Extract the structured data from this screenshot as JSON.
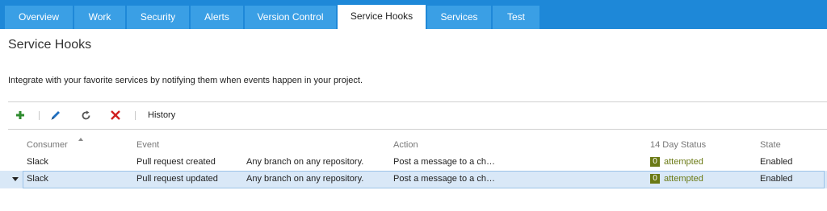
{
  "tabs": [
    {
      "label": "Overview"
    },
    {
      "label": "Work"
    },
    {
      "label": "Security"
    },
    {
      "label": "Alerts"
    },
    {
      "label": "Version Control"
    },
    {
      "label": "Service Hooks",
      "active": true
    },
    {
      "label": "Services"
    },
    {
      "label": "Test"
    }
  ],
  "page": {
    "title": "Service Hooks",
    "description": "Integrate with your favorite services by notifying them when events happen in your project."
  },
  "toolbar": {
    "add_icon": "plus-icon",
    "edit_icon": "pencil-icon",
    "refresh_icon": "refresh-icon",
    "delete_icon": "delete-x-icon",
    "history_label": "History",
    "colors": {
      "add": "#2e8b2e",
      "edit": "#1f6fc0",
      "refresh": "#555555",
      "delete": "#d02020"
    }
  },
  "grid": {
    "columns": {
      "consumer": "Consumer",
      "event": "Event",
      "action": "Action",
      "status": "14 Day Status",
      "state": "State"
    },
    "sort_column": "Consumer",
    "rows": [
      {
        "consumer": "Slack",
        "event": "Pull request created",
        "filter": "Any branch on any repository.",
        "action": "Post a message to a ch…",
        "status_count": "0",
        "status_text": "attempted",
        "state": "Enabled"
      },
      {
        "consumer": "Slack",
        "event": "Pull request updated",
        "filter": "Any branch on any repository.",
        "action": "Post a message to a ch…",
        "status_count": "0",
        "status_text": "attempted",
        "state": "Enabled",
        "selected": true
      }
    ]
  },
  "colors": {
    "tabbar": "#1e88d8",
    "tab": "#3a9fe5",
    "selected_row": "#d9e8f7",
    "status": "#6b7a15"
  }
}
